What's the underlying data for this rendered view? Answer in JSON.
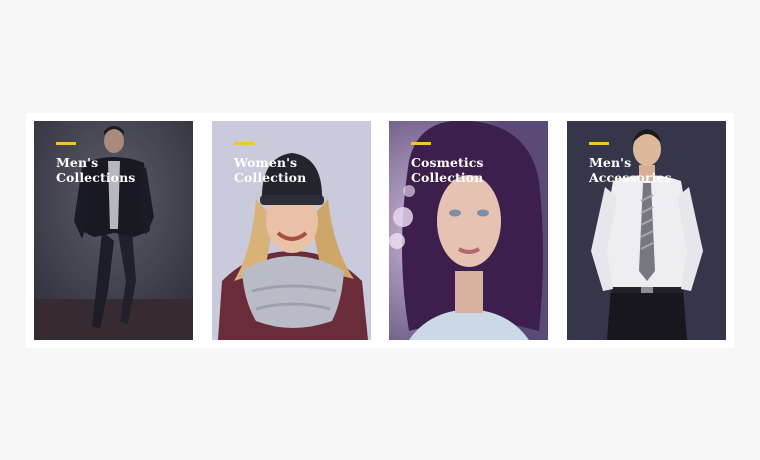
{
  "accent_color": "#f3c623",
  "cards": [
    {
      "line1": "Men's",
      "line2": "Collections",
      "image_subject": "man-in-leather-jacket"
    },
    {
      "line1": "Women's",
      "line2": "Collection",
      "image_subject": "woman-in-beanie-and-scarf"
    },
    {
      "line1": "Cosmetics",
      "line2": "Collection",
      "image_subject": "woman-portrait-purple-hair"
    },
    {
      "line1": "Men's",
      "line2": "Accessories",
      "image_subject": "man-in-shirt-and-tie"
    }
  ]
}
